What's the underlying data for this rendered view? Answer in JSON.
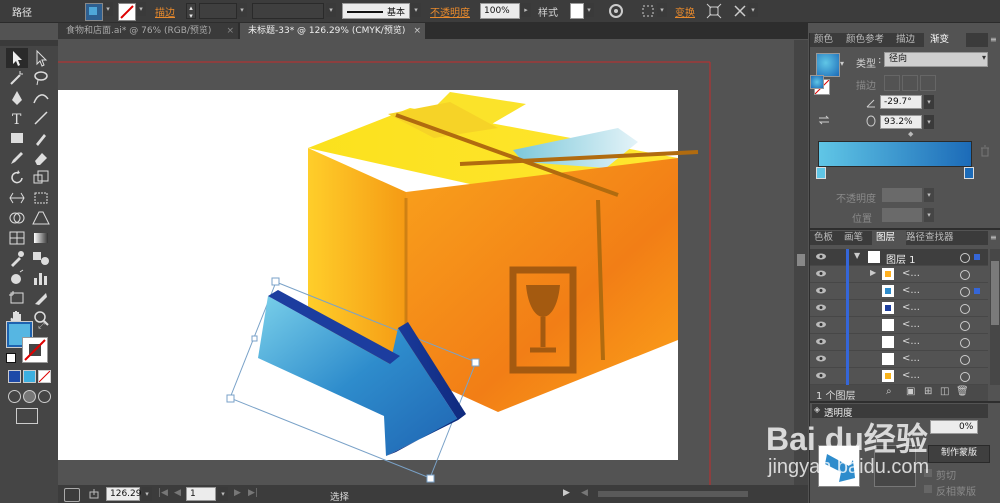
{
  "control_bar": {
    "object_type": "路径",
    "stroke_label": "描边",
    "stroke_style": "基本",
    "opacity_label": "不透明度",
    "opacity_value": "100%",
    "style_label": "样式",
    "transform_label": "变换"
  },
  "doc_tabs": [
    {
      "label": "食物和店面.ai* @ 76% (RGB/预览)"
    },
    {
      "label": "未标题-33* @ 126.29% (CMYK/预览)"
    }
  ],
  "panel_tabs_top": [
    {
      "label": "颜色"
    },
    {
      "label": "颜色参考"
    },
    {
      "label": "描边"
    },
    {
      "label": "渐变"
    }
  ],
  "gradient": {
    "type_label": "类型",
    "type_value": "径向",
    "stroke_label": "描边",
    "angle_value": "-29.7°",
    "aspect_value": "93.2%",
    "opacity_label": "不透明度",
    "location_label": "位置",
    "start_color": "#60c6e6",
    "end_color": "#1c6bb8"
  },
  "panel_tabs_layers": [
    {
      "label": "色板"
    },
    {
      "label": "画笔"
    },
    {
      "label": "图层"
    },
    {
      "label": "路径查找器"
    }
  ],
  "layers": {
    "top_layer": "图层 1",
    "sublayers": [
      {
        "label": "<..."
      },
      {
        "label": "<..."
      },
      {
        "label": "<..."
      },
      {
        "label": "<..."
      },
      {
        "label": "<..."
      },
      {
        "label": "<..."
      },
      {
        "label": "<..."
      }
    ],
    "count_label": "1 个图层"
  },
  "transparency": {
    "title": "透明度",
    "value": "0%",
    "make_mask_label": "制作蒙版",
    "clip_label": "剪切",
    "invert_label": "反相蒙版"
  },
  "status_bar": {
    "zoom": "126.29",
    "page": "1",
    "tool": "选择"
  },
  "watermark": {
    "brand": "Bai du经验",
    "url": "jingyan.baidu.com"
  }
}
